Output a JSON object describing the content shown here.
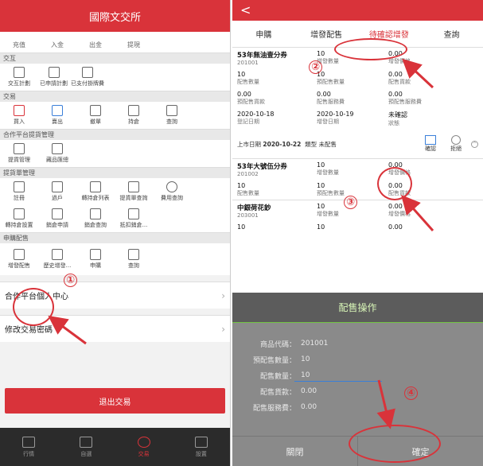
{
  "left": {
    "title": "國際文交所",
    "top_row": [
      "充值",
      "入金",
      "出金",
      "提現"
    ],
    "sections": [
      {
        "header": "交互",
        "items": [
          "交互計劃",
          "已申請計劃",
          "已支付掛牌費"
        ]
      },
      {
        "header": "交易",
        "items": [
          "買入",
          "賣出",
          "撤單",
          "持倉",
          "查詢"
        ]
      },
      {
        "header": "合作平台提貨管理",
        "items": [
          "提貨管理",
          "藏品匯總"
        ]
      },
      {
        "header": "提貨單管理",
        "items": [
          "註冊",
          "過戶",
          "轉持倉列表",
          "提貨單查詢",
          "費用查詢"
        ],
        "items2": [
          "轉持倉設置",
          "銷倉申請",
          "銷倉查詢",
          "抵扣銷倉..."
        ]
      },
      {
        "header": "申購配售",
        "items": [
          "增發配售",
          "歷史增發...",
          "申購",
          "查詢"
        ]
      }
    ],
    "menu": [
      "合作平台個人中心",
      "修改交易密碼"
    ],
    "exit_label": "退出交易",
    "tabs": [
      "行情",
      "自選",
      "交易",
      "設置"
    ]
  },
  "right": {
    "back": "<",
    "tabs": [
      "申購",
      "增發配售",
      "待確認增發",
      "查詢"
    ],
    "item1": {
      "row1": [
        [
          "53年無油壹分券",
          "201001"
        ],
        [
          "10",
          "增發數量"
        ],
        [
          "0.00",
          "增發價格"
        ]
      ],
      "row2": [
        [
          "10",
          "配售數量"
        ],
        [
          "10",
          "預配售數量"
        ],
        [
          "0.00",
          "配售貨款"
        ]
      ],
      "row3": [
        [
          "0.00",
          "預配售貨款"
        ],
        [
          "0.00",
          "配售服務費"
        ],
        [
          "0.00",
          "預配售服務費"
        ]
      ],
      "row4": [
        [
          "2020-10-18",
          "登記日期"
        ],
        [
          "2020-10-19",
          "增發日期"
        ],
        [
          "未確認",
          "狀態"
        ]
      ],
      "listing_label": "上市日期",
      "listing_date": "2020-10-22",
      "type_label": "類型",
      "type_value": "未配售",
      "confirm": "確認",
      "reject": "拒絕"
    },
    "item2": {
      "row1": [
        [
          "53年大號伍分券",
          "201002"
        ],
        [
          "10",
          "增發數量"
        ],
        [
          "0.00",
          "增發價格"
        ]
      ],
      "row2": [
        [
          "10",
          "配售數量"
        ],
        [
          "10",
          "預配售數量"
        ],
        [
          "0.00",
          "配售貨款"
        ]
      ]
    },
    "item3": {
      "row1": [
        [
          "中銀荷花鈔",
          "203001"
        ],
        [
          "10",
          "增發數量"
        ],
        [
          "0.00",
          "增發價格"
        ]
      ],
      "row2": [
        [
          "10",
          ""
        ],
        [
          "10",
          ""
        ],
        [
          "0.00",
          ""
        ]
      ]
    },
    "sheet": {
      "title": "配售操作",
      "fields": [
        [
          "商品代碼：",
          "201001"
        ],
        [
          "預配售數量：",
          "10"
        ],
        [
          "配售數量：",
          "10"
        ],
        [
          "配售貨款：",
          "0.00"
        ],
        [
          "配售服務費：",
          "0.00"
        ]
      ],
      "close": "關閉",
      "confirm": "確定"
    }
  },
  "annotations": [
    "①",
    "②",
    "③",
    "④"
  ],
  "colors": {
    "brand_red": "#d9333a",
    "accent_blue": "#3a7fd9",
    "sheet_green": "#72c443"
  }
}
